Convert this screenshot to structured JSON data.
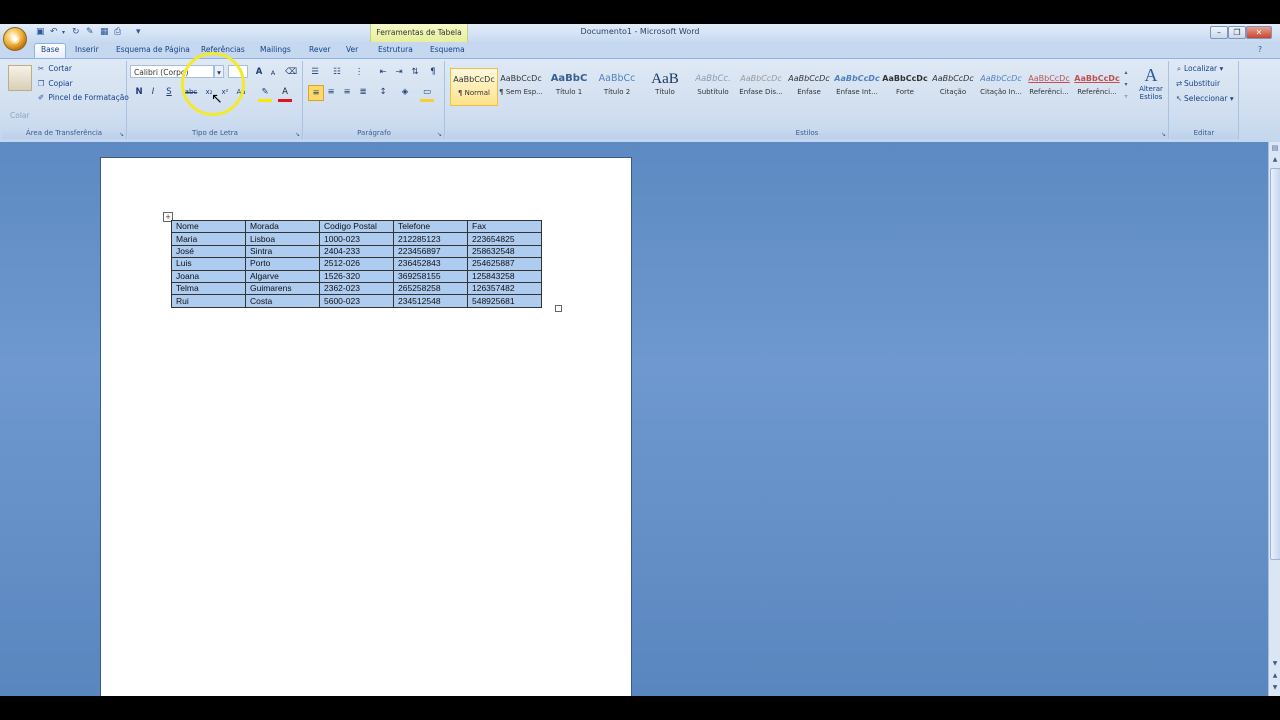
{
  "app_title": "Documento1 - Microsoft Word",
  "context_tab_title": "Ferramentas de Tabela",
  "tabs": [
    {
      "label": "Base",
      "active": true
    },
    {
      "label": "Inserir"
    },
    {
      "label": "Esquema de Página"
    },
    {
      "label": "Referências"
    },
    {
      "label": "Mailings"
    },
    {
      "label": "Rever"
    },
    {
      "label": "Ver"
    },
    {
      "label": "Estrutura"
    },
    {
      "label": "Esquema"
    }
  ],
  "clipboard": {
    "paste_label": "Colar",
    "cut_label": "Cortar",
    "copy_label": "Copiar",
    "format_painter_label": "Pincel de Formatação",
    "group_label": "Área de Transferência"
  },
  "font": {
    "font_name": "Calibri (Corpo)",
    "font_size": "",
    "group_label": "Tipo de Letra",
    "bold": "N",
    "italic": "I",
    "underline": "S",
    "strike": "abc",
    "subscript": "x₂",
    "superscript": "x²",
    "case": "Aa",
    "grow": "A",
    "shrink": "A"
  },
  "paragraph": {
    "group_label": "Parágrafo"
  },
  "styles": {
    "group_label": "Estilos",
    "change_styles_label": "Alterar Estilos",
    "items": [
      {
        "sample": "AaBbCcDc",
        "name": "¶ Normal",
        "selected": true
      },
      {
        "sample": "AaBbCcDc",
        "name": "¶ Sem Esp..."
      },
      {
        "sample": "AaBbC",
        "name": "Título 1"
      },
      {
        "sample": "AaBbCc",
        "name": "Título 2"
      },
      {
        "sample": "AaB",
        "name": "Título"
      },
      {
        "sample": "AaBbCc.",
        "name": "Subtítulo"
      },
      {
        "sample": "AaBbCcDc",
        "name": "Ênfase Dis..."
      },
      {
        "sample": "AaBbCcDc",
        "name": "Ênfase"
      },
      {
        "sample": "AaBbCcDc",
        "name": "Ênfase Int..."
      },
      {
        "sample": "AaBbCcDc",
        "name": "Forte"
      },
      {
        "sample": "AaBbCcDc",
        "name": "Citação"
      },
      {
        "sample": "AaBbCcDc",
        "name": "Citação In..."
      },
      {
        "sample": "AaBbCcDc",
        "name": "Referênci..."
      },
      {
        "sample": "AaBbCcDc",
        "name": "Referênci..."
      }
    ]
  },
  "editing": {
    "group_label": "Editar",
    "find_label": "Localizar",
    "replace_label": "Substituir",
    "select_label": "Seleccionar"
  },
  "table": {
    "headers": [
      "Nome",
      "Morada",
      "Codigo Postal",
      "Telefone",
      "Fax"
    ],
    "rows": [
      [
        "Maria",
        "Lisboa",
        "1000-023",
        "212285123",
        "223654825"
      ],
      [
        "José",
        "Sintra",
        "2404-233",
        "223456897",
        "258632548"
      ],
      [
        "Luis",
        "Porto",
        "2512-026",
        "236452843",
        "254625887"
      ],
      [
        "Joana",
        "Algarve",
        "1526-320",
        "369258155",
        "125843258"
      ],
      [
        "Telma",
        "Guimarens",
        "2362-023",
        "265258258",
        "126357482"
      ],
      [
        "Rui",
        "Costa",
        "5600-023",
        "234512548",
        "548925681"
      ]
    ]
  },
  "colors": {
    "ribbon": "#dfe9f5",
    "document_background": "#6e98cf",
    "selection": "#aecbf0",
    "highlight_ring": "#f2ea2a",
    "context_tab": "#e5ef9c"
  }
}
